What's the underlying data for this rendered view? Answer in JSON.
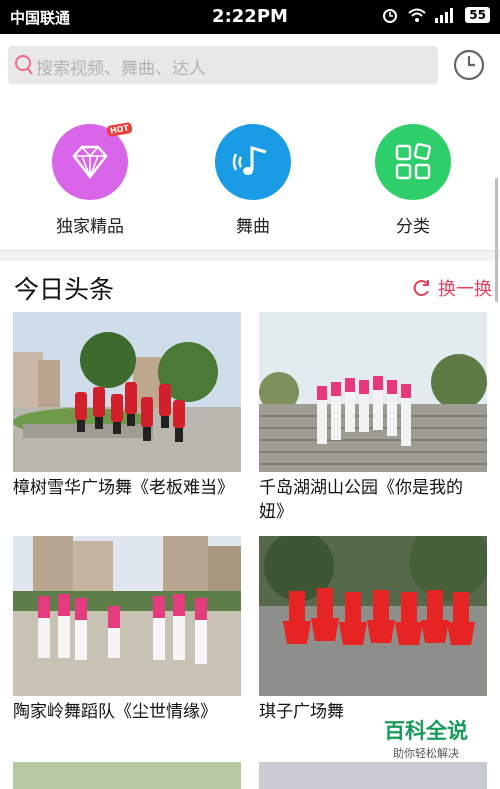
{
  "status": {
    "carrier": "中国联通",
    "time": "2:22PM",
    "battery": "55"
  },
  "search": {
    "placeholder": "搜索视频、舞曲、达人"
  },
  "categories": [
    {
      "label": "独家精品",
      "color": "#d966e8",
      "badge": "HOT",
      "icon": "diamond-icon"
    },
    {
      "label": "舞曲",
      "color": "#1a9be6",
      "icon": "music-note-icon"
    },
    {
      "label": "分类",
      "color": "#2ecf6a",
      "icon": "grid-icon"
    }
  ],
  "section": {
    "title": "今日头条",
    "refresh_label": "换一换"
  },
  "videos": [
    {
      "title": "樟树雪华广场舞《老板难当》"
    },
    {
      "title": "千岛湖湖山公园《你是我的妞》"
    },
    {
      "title": "陶家岭舞蹈队《尘世情缘》"
    },
    {
      "title": "琪子广场舞"
    }
  ],
  "watermark": {
    "brand": "百科全说",
    "slogan": "助你轻松解决"
  }
}
